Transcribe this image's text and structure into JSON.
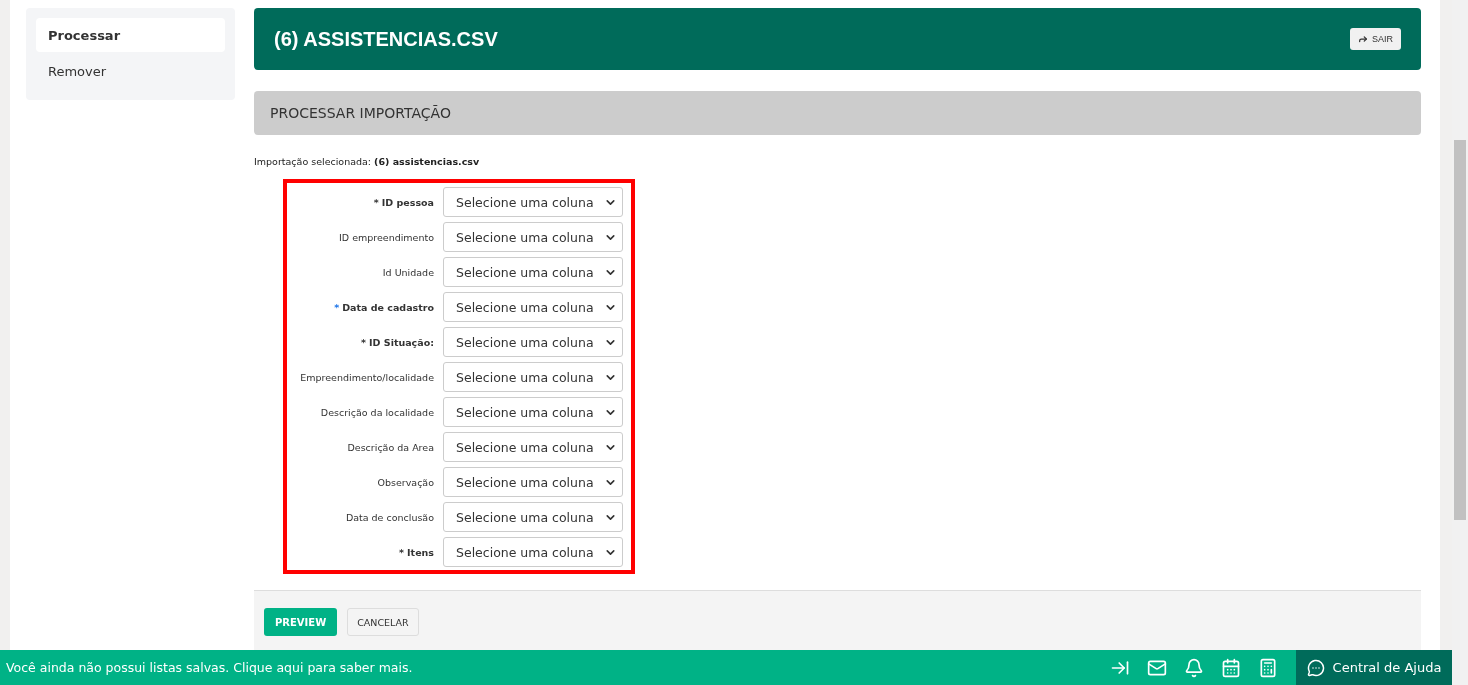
{
  "sidebar": {
    "items": [
      {
        "label": "Processar",
        "selected": true
      },
      {
        "label": "Remover",
        "selected": false
      }
    ]
  },
  "header": {
    "title": "(6) ASSISTENCIAS.CSV",
    "exit_button": "SAIR"
  },
  "section": {
    "title": "PROCESSAR IMPORTAÇÃO"
  },
  "selected_import": {
    "label": "Importação selecionada:",
    "value": "(6) assistencias.csv"
  },
  "fields": [
    {
      "marker": "*",
      "label": "ID pessoa",
      "required": true,
      "value": "Selecione uma coluna"
    },
    {
      "label": "ID empreendimento",
      "required": false,
      "value": "Selecione uma coluna"
    },
    {
      "label": "Id Unidade",
      "required": false,
      "value": "Selecione uma coluna"
    },
    {
      "marker": "*",
      "label": "Data de cadastro",
      "required": true,
      "value": "Selecione uma coluna"
    },
    {
      "marker": "*",
      "label": "ID Situação:",
      "required": true,
      "value": "Selecione uma coluna"
    },
    {
      "label": "Empreendimento/localidade",
      "required": false,
      "value": "Selecione uma coluna"
    },
    {
      "label": "Descrição da localidade",
      "required": false,
      "value": "Selecione uma coluna"
    },
    {
      "label": "Descrição da Area",
      "required": false,
      "value": "Selecione uma coluna"
    },
    {
      "label": "Observação",
      "required": false,
      "value": "Selecione uma coluna"
    },
    {
      "label": "Data de conclusão",
      "required": false,
      "value": "Selecione uma coluna"
    },
    {
      "marker": "*",
      "label": "Itens",
      "required": true,
      "value": "Selecione uma coluna"
    }
  ],
  "actions": {
    "preview": "PREVIEW",
    "cancel": "CANCELAR"
  },
  "bottom_bar": {
    "message": "Você ainda não possui listas salvas. Clique aqui para saber mais.",
    "help": "Central de Ajuda"
  }
}
